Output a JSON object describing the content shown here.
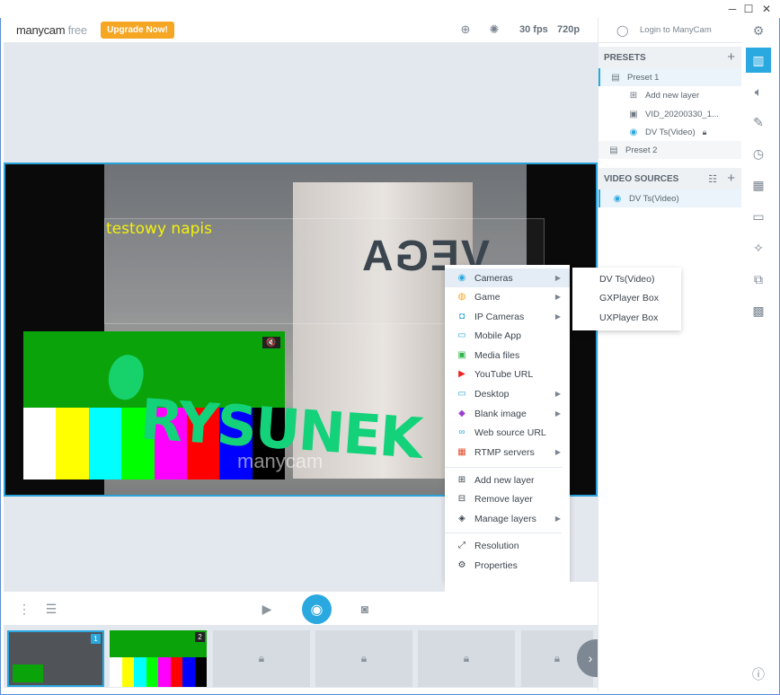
{
  "app": {
    "logo_main": "manycam",
    "logo_free": "free",
    "upgrade_label": "Upgrade Now!",
    "fps": "30 fps",
    "resolution": "720p",
    "login_label": "Login to ManyCam"
  },
  "window": {
    "minimize": "─",
    "maximize": "☐",
    "close": "✕"
  },
  "video": {
    "text_overlay": "testowy napis",
    "brand_on_box": "VEGA",
    "drawn_text": "RYSUNEK",
    "watermark": "manycam"
  },
  "presets": {
    "header": "PRESETS",
    "items": [
      {
        "label": "Preset 1"
      },
      {
        "label": "Add new layer"
      },
      {
        "label": "VID_20200330_1..."
      },
      {
        "label": "DV Ts(Video)"
      },
      {
        "label": "Preset 2"
      }
    ]
  },
  "video_sources": {
    "header": "VIDEO SOURCES",
    "items": [
      {
        "label": "DV Ts(Video)"
      }
    ]
  },
  "menu": {
    "items": [
      {
        "label": "Cameras"
      },
      {
        "label": "Game"
      },
      {
        "label": "IP Cameras"
      },
      {
        "label": "Mobile App"
      },
      {
        "label": "Media files"
      },
      {
        "label": "YouTube URL"
      },
      {
        "label": "Desktop"
      },
      {
        "label": "Blank image"
      },
      {
        "label": "Web source URL"
      },
      {
        "label": "RTMP servers"
      },
      {
        "label": "Add new layer"
      },
      {
        "label": "Remove layer"
      },
      {
        "label": "Manage layers"
      },
      {
        "label": "Resolution"
      },
      {
        "label": "Properties"
      }
    ],
    "submenu": [
      {
        "label": "DV Ts(Video)"
      },
      {
        "label": "GXPlayer Box"
      },
      {
        "label": "UXPlayer Box"
      }
    ]
  },
  "thumbnails": [
    {
      "number": "1"
    },
    {
      "number": "2"
    }
  ],
  "colors": {
    "accent": "#2aa8e0",
    "upgrade": "#f5a623",
    "overlay_text": "#f2f20a",
    "drawing": "#14d27a",
    "test_bars": [
      "#ffffff",
      "#ffff00",
      "#00ffff",
      "#00ff00",
      "#ff00ff",
      "#ff0000",
      "#0000ff",
      "#000000"
    ]
  }
}
